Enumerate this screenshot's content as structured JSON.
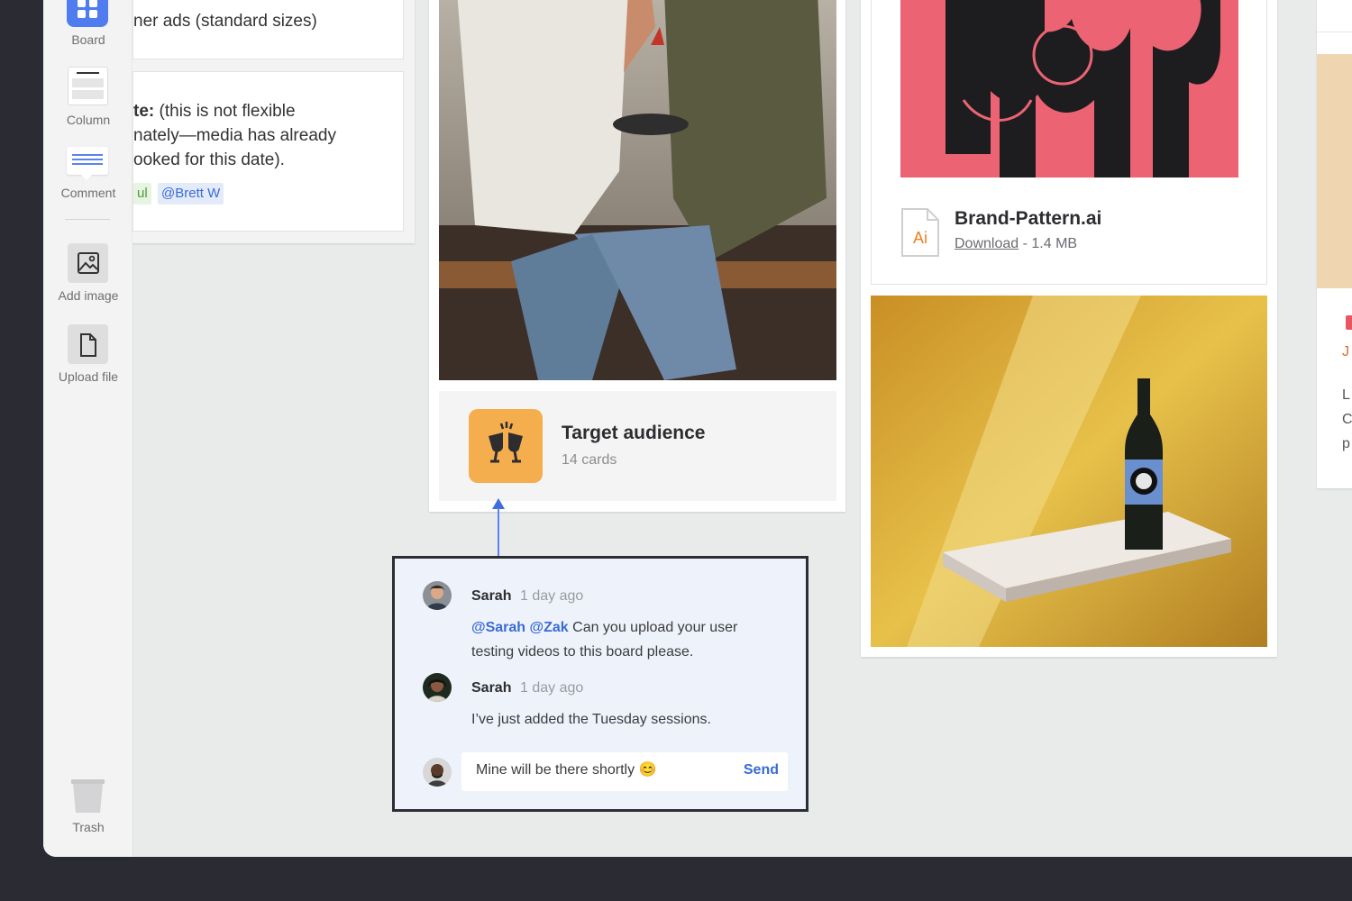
{
  "sidebar": {
    "board_label": "Board",
    "column_label": "Column",
    "comment_label": "Comment",
    "add_image_label": "Add image",
    "upload_file_label": "Upload file",
    "trash_label": "Trash"
  },
  "left_column": {
    "note1_text": "ner ads (standard sizes)",
    "note2_bold": "te:",
    "note2_lines": [
      "(this is not flexible",
      "nately—media has already",
      "ooked for this date)."
    ],
    "tags": [
      "ul",
      "@Brett W"
    ]
  },
  "board_link": {
    "title": "Target audience",
    "subtitle": "14 cards"
  },
  "comment_thread": {
    "comments": [
      {
        "author": "Sarah",
        "time": "1 day ago",
        "mentions": "@Sarah @Zak",
        "text": " Can you upload your user testing videos to this board please."
      },
      {
        "author": "Sarah",
        "time": "1 day ago",
        "mentions": "",
        "text": "I’ve just added the Tuesday sessions."
      }
    ],
    "reply_value": "Mine will be there shortly 😊",
    "send_label": "Send"
  },
  "file": {
    "icon_label": "Ai",
    "name": "Brand-Pattern.ai",
    "download_label": "Download",
    "size": "- 1.4 MB"
  },
  "far_column": {
    "letters": [
      "J",
      "L",
      "C",
      "p"
    ]
  },
  "colors": {
    "accent": "#3a6bd6",
    "board_icon": "#f5ae4d",
    "pattern_bg": "#ec6473",
    "comment_bg": "#eef3fb"
  }
}
